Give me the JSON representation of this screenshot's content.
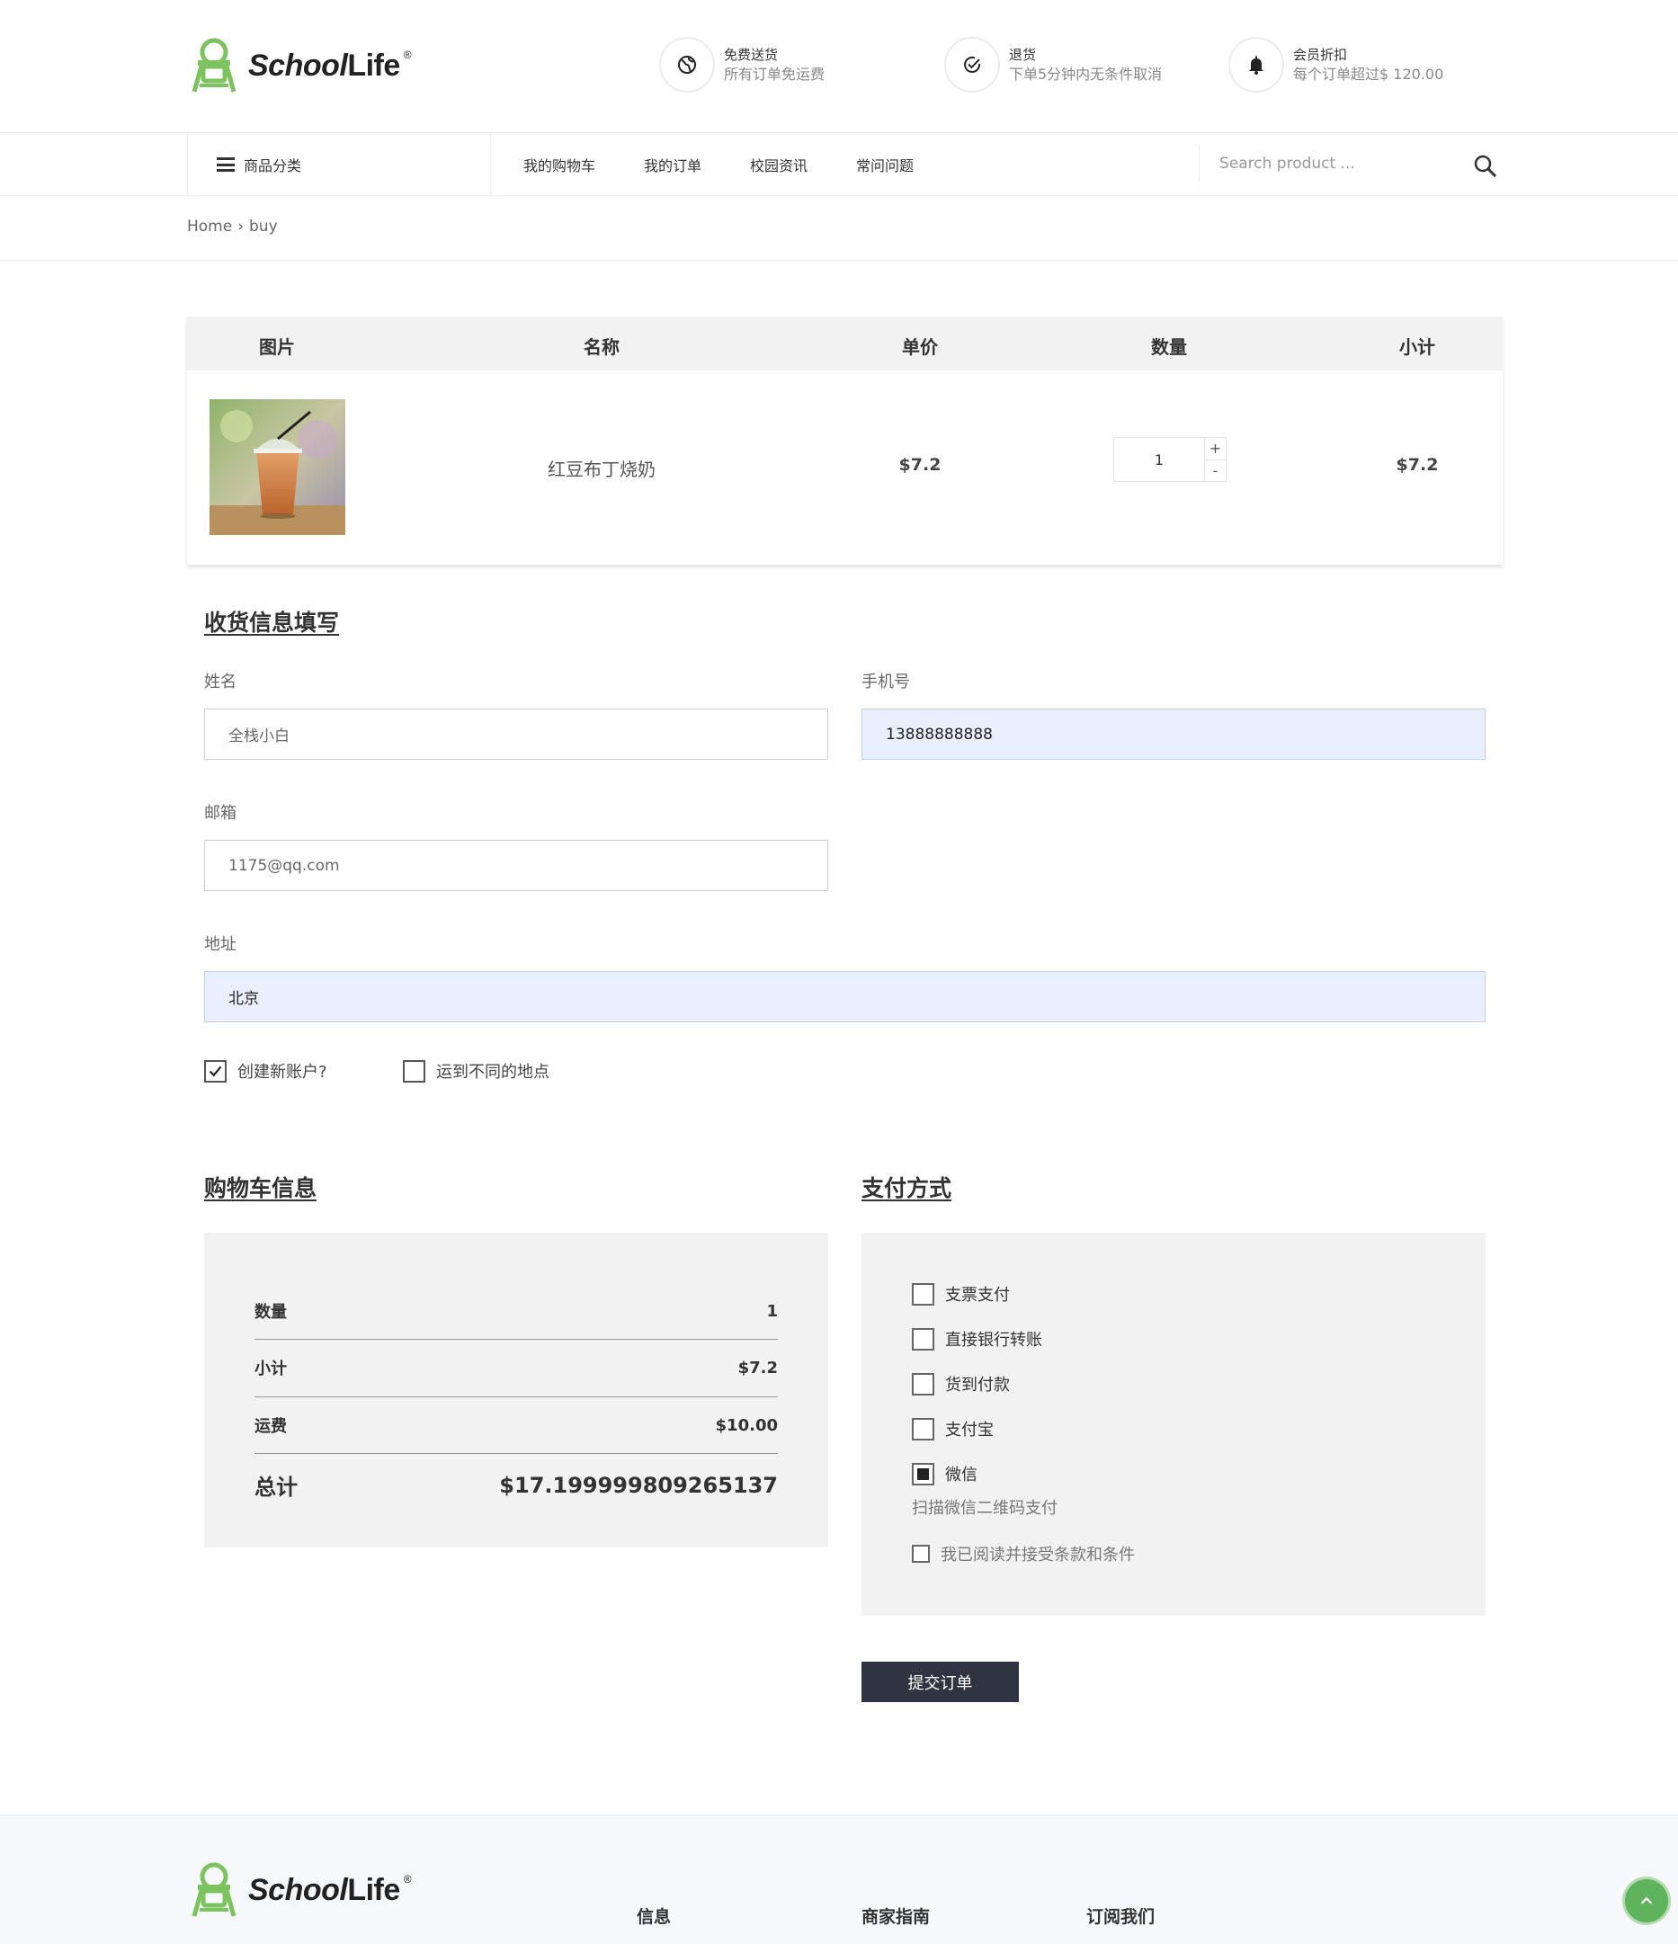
{
  "brand": {
    "name_part1": "School",
    "name_part2": "Life",
    "reg": "®",
    "accent_color": "#7cc35f"
  },
  "features": [
    {
      "icon": "globe-icon",
      "title": "免费送货",
      "desc": "所有订单免运费"
    },
    {
      "icon": "check-circle-icon",
      "title": "退货",
      "desc": "下单5分钟内无条件取消"
    },
    {
      "icon": "bell-icon",
      "title": "会员折扣",
      "desc": "每个订单超过$ 120.00"
    }
  ],
  "nav": {
    "category_label": "商品分类",
    "links": [
      "我的购物车",
      "我的订单",
      "校园资讯",
      "常问问题"
    ],
    "search_placeholder": "Search product ..."
  },
  "breadcrumb": {
    "home": "Home",
    "sep": "›",
    "current": "buy"
  },
  "cart": {
    "headers": [
      "图片",
      "名称",
      "单价",
      "数量",
      "小计"
    ],
    "items": [
      {
        "name": "红豆布丁烧奶",
        "price": "$7.2",
        "quantity": "1",
        "subtotal": "$7.2"
      }
    ],
    "qty_plus": "+",
    "qty_minus": "-"
  },
  "shipping": {
    "title": "收货信息填写",
    "name_label": "姓名",
    "name_value": "全栈小白",
    "phone_label": "手机号",
    "phone_value": "13888888888",
    "email_label": "邮箱",
    "email_value": "1175@qq.com",
    "address_label": "地址",
    "address_value": "北京",
    "create_account_label": "创建新账户?",
    "create_account_checked": true,
    "ship_different_label": "运到不同的地点",
    "ship_different_checked": false
  },
  "summary": {
    "title": "购物车信息",
    "qty_label": "数量",
    "qty_value": "1",
    "subtotal_label": "小计",
    "subtotal_value": "$7.2",
    "shipping_label": "运费",
    "shipping_value": "$10.00",
    "total_label": "总计",
    "total_value": "$17.199999809265137"
  },
  "payment": {
    "title": "支付方式",
    "options": [
      {
        "label": "支票支付",
        "checked": false
      },
      {
        "label": "直接银行转账",
        "checked": false
      },
      {
        "label": "货到付款",
        "checked": false
      },
      {
        "label": "支付宝",
        "checked": false
      },
      {
        "label": "微信",
        "checked": true
      }
    ],
    "note": "扫描微信二维码支付",
    "terms_label": "我已阅读并接受条款和条件",
    "submit_label": "提交订单"
  },
  "footer": {
    "headings": [
      "信息",
      "商家指南",
      "订阅我们"
    ]
  }
}
